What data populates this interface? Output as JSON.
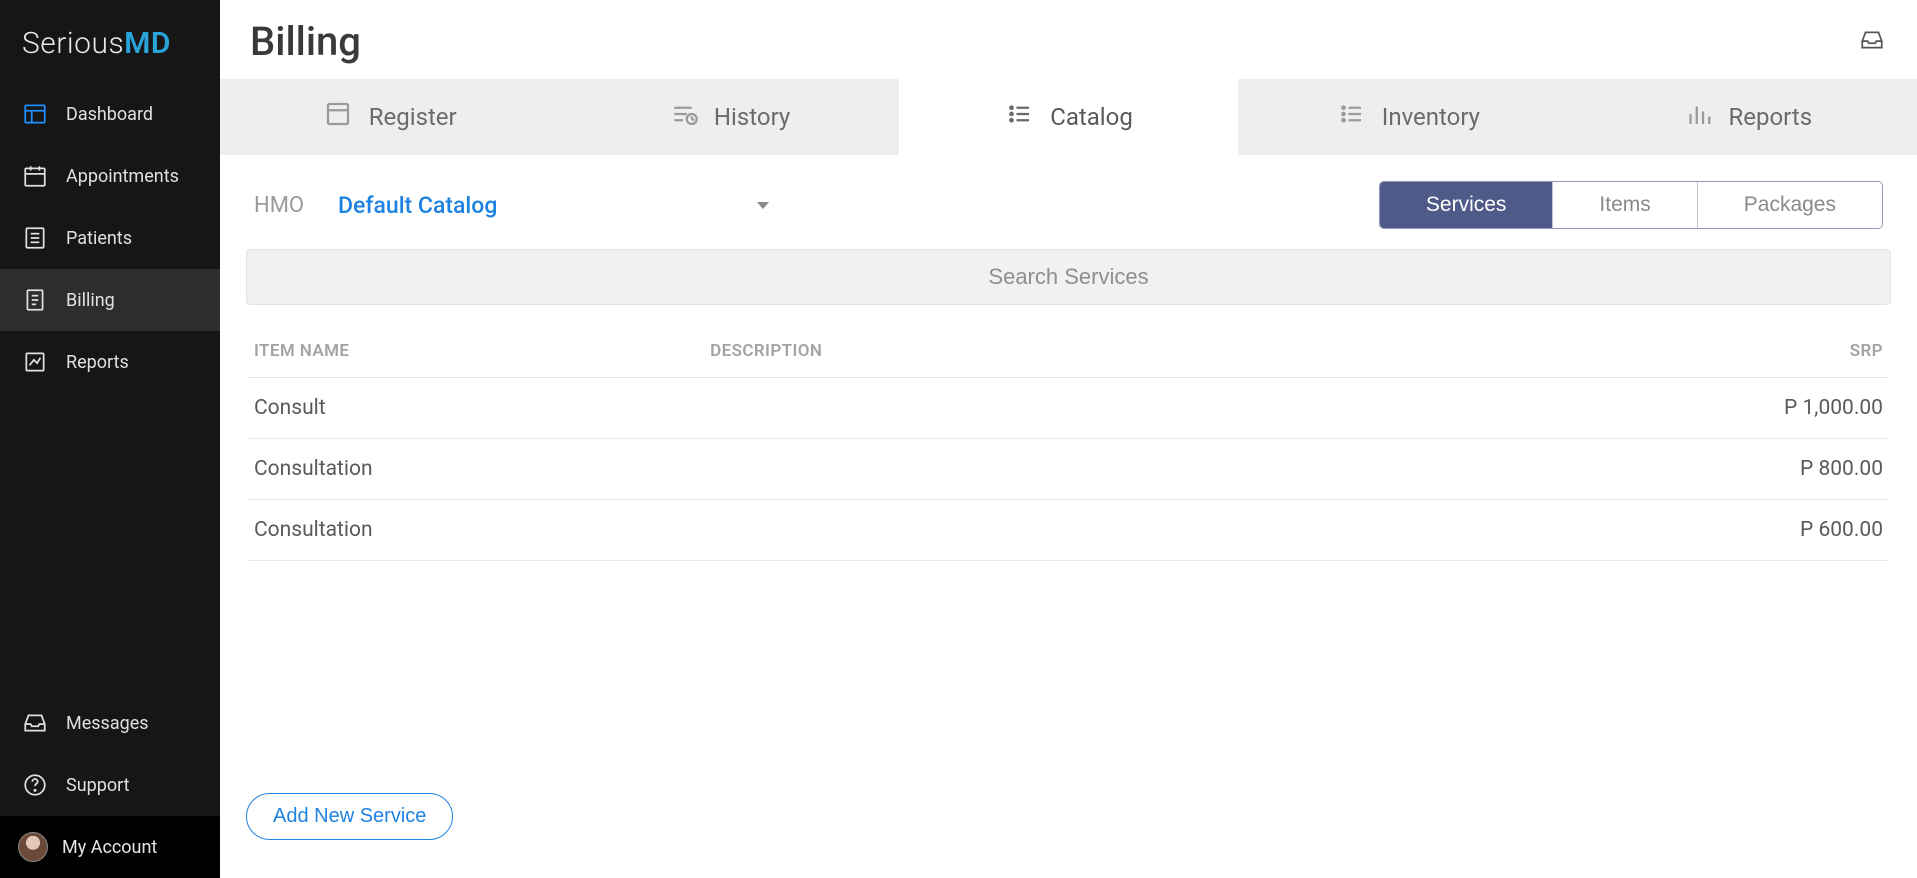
{
  "brand": {
    "name": "Serious",
    "suffix_m": "M",
    "suffix_d": "D"
  },
  "sidebar": {
    "items": [
      {
        "label": "Dashboard"
      },
      {
        "label": "Appointments"
      },
      {
        "label": "Patients"
      },
      {
        "label": "Billing"
      },
      {
        "label": "Reports"
      }
    ],
    "footer": [
      {
        "label": "Messages"
      },
      {
        "label": "Support"
      }
    ],
    "account": "My Account"
  },
  "page": {
    "title": "Billing"
  },
  "subtabs": [
    {
      "label": "Register"
    },
    {
      "label": "History"
    },
    {
      "label": "Catalog"
    },
    {
      "label": "Inventory"
    },
    {
      "label": "Reports"
    }
  ],
  "filter": {
    "hmo_label": "HMO",
    "catalog_name": "Default Catalog"
  },
  "segments": {
    "services": "Services",
    "items": "Items",
    "packages": "Packages"
  },
  "search": {
    "placeholder": "Search Services"
  },
  "table": {
    "headers": {
      "name": "ITEM NAME",
      "desc": "DESCRIPTION",
      "srp": "SRP"
    },
    "rows": [
      {
        "name": "Consult",
        "desc": "",
        "srp": "P 1,000.00"
      },
      {
        "name": "Consultation",
        "desc": "",
        "srp": "P 800.00"
      },
      {
        "name": "Consultation",
        "desc": "",
        "srp": "P 600.00"
      }
    ]
  },
  "buttons": {
    "add_service": "Add New Service"
  }
}
